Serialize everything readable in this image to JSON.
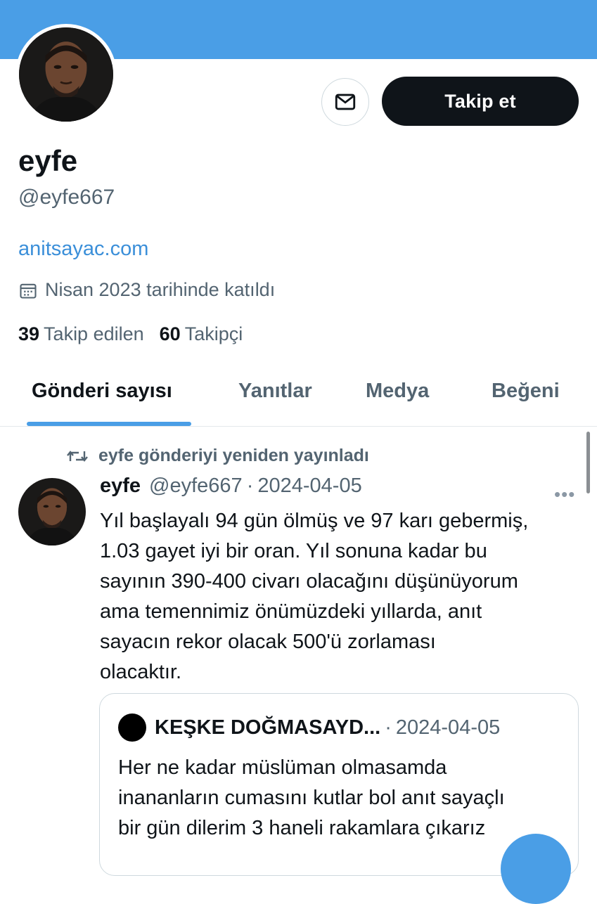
{
  "profile": {
    "name": "eyfe",
    "handle": "@eyfe667",
    "website": "anitsayac.com",
    "joined": "Nisan 2023 tarihinde katıldı",
    "following_count": "39",
    "following_label": "Takip edilen",
    "followers_count": "60",
    "followers_label": "Takipçi",
    "follow_button": "Takip et"
  },
  "icons": {
    "message": "envelope-icon",
    "calendar": "calendar-icon",
    "retweet": "retweet-icon",
    "more": "more-icon"
  },
  "tabs": [
    {
      "label": "Gönderi sayısı",
      "active": true
    },
    {
      "label": "Yanıtlar",
      "active": false
    },
    {
      "label": "Medya",
      "active": false
    },
    {
      "label": "Beğeni",
      "active": false
    }
  ],
  "tweet": {
    "retweet_label": "eyfe gönderiyi yeniden yayınladı",
    "author_name": "eyfe",
    "author_handle": "@eyfe667",
    "separator": "·",
    "date": "2024-04-05",
    "more": "•••",
    "text": "Yıl başlayalı 94 gün ölmüş ve 97 karı gebermiş,\n1.03 gayet iyi bir oran. Yıl sonuna kadar bu\nsayının 390-400 civarı olacağını düşünüyorum\nama temennimiz önümüzdeki yıllarda, anıt\nsayacın rekor olacak 500'ü zorlaması\nolacaktır.",
    "quote": {
      "author_name": "KEŞKE DOĞMASAYD...",
      "separator": "·",
      "date": "2024-04-05",
      "text": "Her ne kadar müslüman olmasamda\ninananların cumasını kutlar bol anıt sayaçlı\nbir gün dilerim 3 haneli rakamlara çıkarız"
    }
  },
  "colors": {
    "banner": "#4a9ee6",
    "link": "#3b8fd9",
    "text_primary": "#0f1419",
    "text_secondary": "#536471"
  }
}
